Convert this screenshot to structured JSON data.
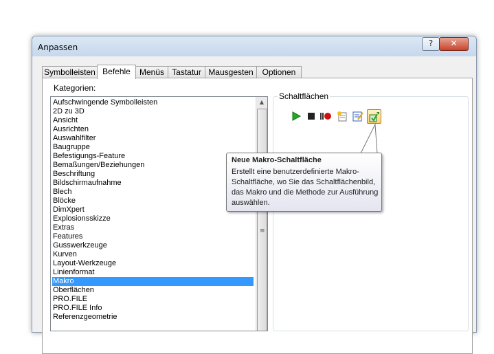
{
  "window": {
    "title": "Anpassen",
    "help_glyph": "?",
    "close_glyph": "✕"
  },
  "tabs": [
    "Symbolleisten",
    "Befehle",
    "Menüs",
    "Tastatur",
    "Mausgesten",
    "Optionen"
  ],
  "active_tab": "Befehle",
  "categories_label": "Kategorien:",
  "categories": [
    "Aufschwingende Symbolleisten",
    "2D zu 3D",
    "Ansicht",
    "Ausrichten",
    "Auswahlfilter",
    "Baugruppe",
    "Befestigungs-Feature",
    "Bemaßungen/Beziehungen",
    "Beschriftung",
    "Bildschirmaufnahme",
    "Blech",
    "Blöcke",
    "DimXpert",
    "Explosionsskizze",
    "Extras",
    "Features",
    "Gusswerkzeuge",
    "Kurven",
    "Layout-Werkzeuge",
    "Linienformat",
    "Makro",
    "Oberflächen",
    "PRO.FILE",
    "PRO.FILE Info",
    "Referenzgeometrie"
  ],
  "selected_category": "Makro",
  "buttons_group_label": "Schaltflächen",
  "macro_buttons": [
    {
      "icon": "run-macro-icon",
      "color": "#22aa22"
    },
    {
      "icon": "stop-macro-icon",
      "color": "#222222"
    },
    {
      "icon": "record-pause-macro-icon",
      "color": "#d01010"
    },
    {
      "icon": "new-macro-icon",
      "color": "#e0a020"
    },
    {
      "icon": "edit-macro-icon",
      "color": "#3060c0"
    },
    {
      "icon": "new-macro-button-icon",
      "color": "#30a030"
    }
  ],
  "tooltip": {
    "title": "Neue Makro-Schaltfläche",
    "body": "Erstellt eine benutzerdefinierte Makro-Schaltfläche, wo Sie das Schaltflächenbild, das Makro und die Methode zur Ausführung auswählen."
  }
}
